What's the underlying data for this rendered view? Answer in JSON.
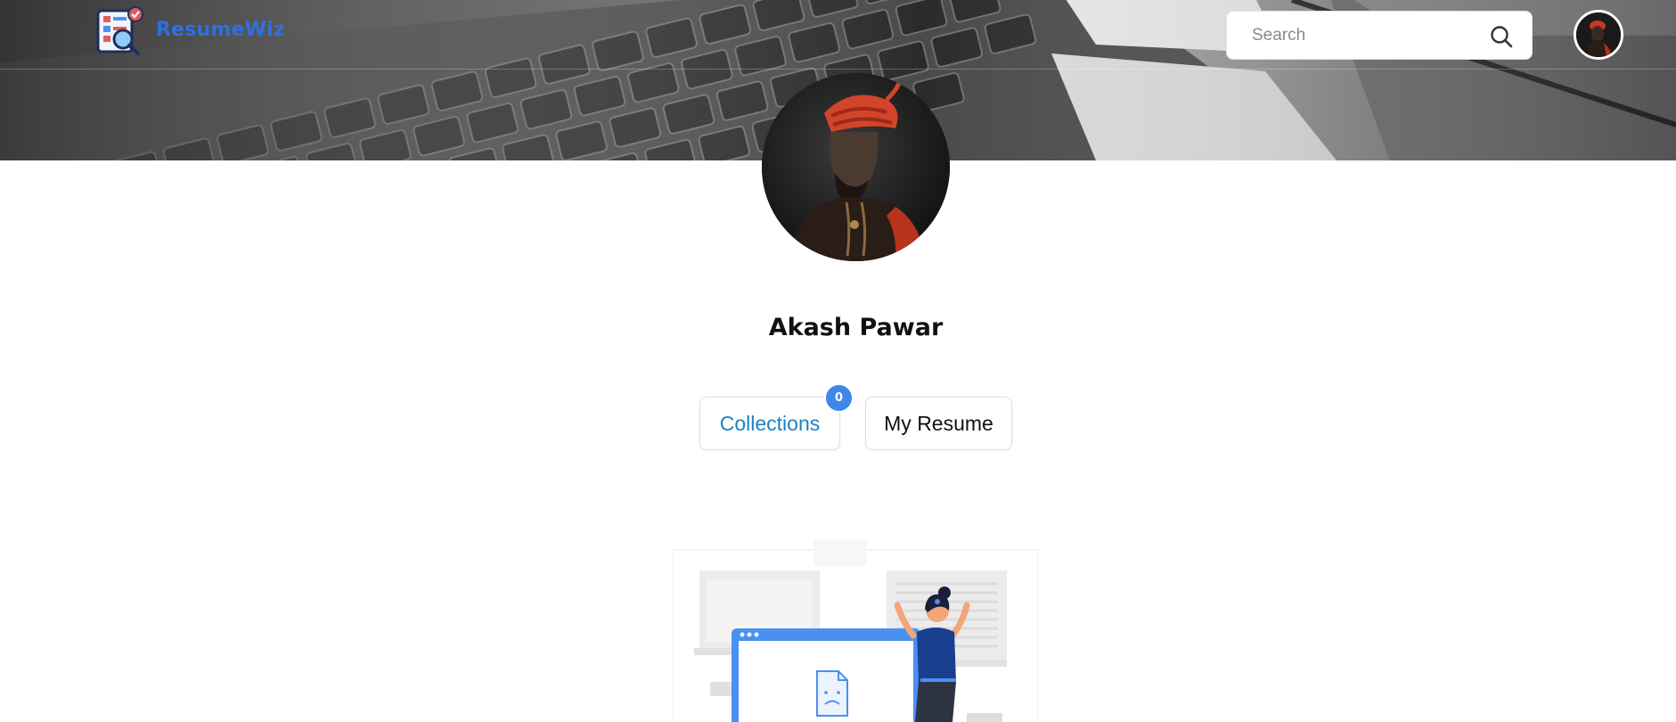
{
  "header": {
    "brand_name": "ResumeWiz",
    "search": {
      "placeholder": "Search",
      "value": ""
    }
  },
  "profile": {
    "name": "Akash Pawar",
    "collections_label": "Collections",
    "collections_count": "0",
    "my_resume_label": "My Resume"
  },
  "colors": {
    "brand_blue": "#2f6fe0",
    "collections_text": "#1c82c4",
    "badge_blue": "#3f87ea",
    "illustration_blue": "#4a90f0",
    "illustration_navy": "#1b3f8f"
  },
  "icons": {
    "brand_logo": "resume-magnifier-logo-icon",
    "search": "search-icon"
  }
}
